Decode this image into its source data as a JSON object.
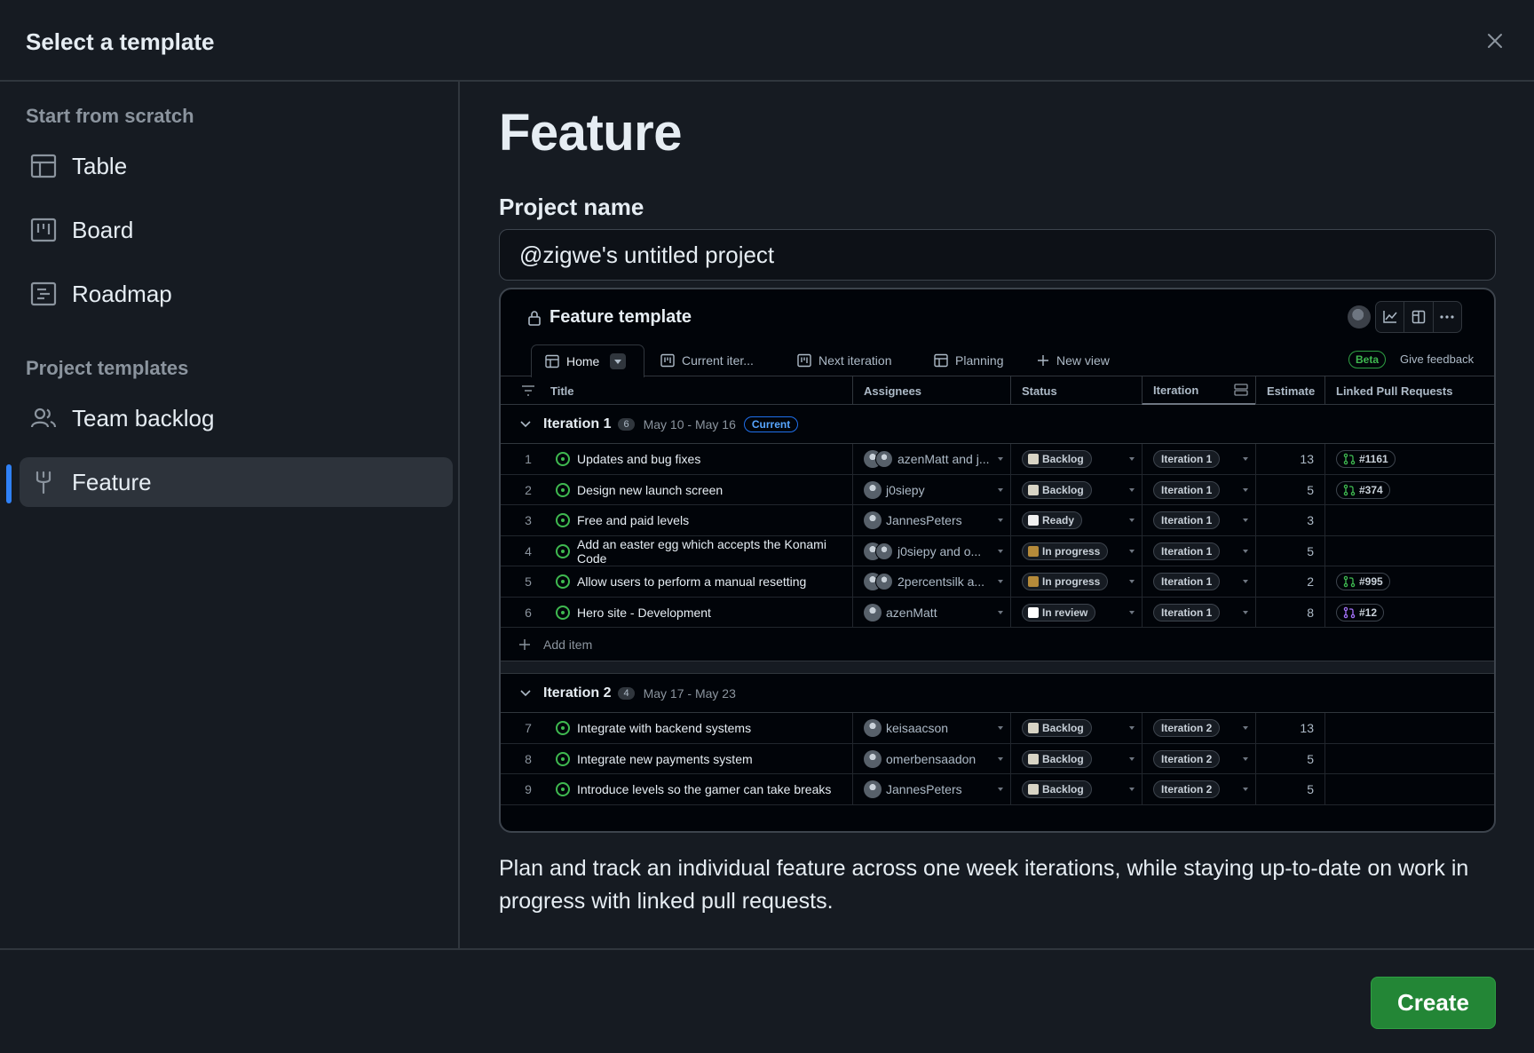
{
  "dialog": {
    "title": "Select a template",
    "close_label": "×"
  },
  "sidebar": {
    "scratch_heading": "Start from scratch",
    "scratch_items": [
      {
        "label": "Table",
        "icon": "table-icon"
      },
      {
        "label": "Board",
        "icon": "board-icon"
      },
      {
        "label": "Roadmap",
        "icon": "roadmap-icon"
      }
    ],
    "templates_heading": "Project templates",
    "template_items": [
      {
        "label": "Team backlog",
        "icon": "people-icon"
      },
      {
        "label": "Feature",
        "icon": "feature-icon",
        "selected": true
      }
    ]
  },
  "main": {
    "template_title": "Feature",
    "project_name_label": "Project name",
    "project_name_value": "@zigwe's untitled project",
    "description": "Plan and track an individual feature across one week iterations, while staying up-to-date on work in progress with linked pull requests."
  },
  "preview": {
    "title": "Feature template",
    "tabs": [
      "Home",
      "Current iter...",
      "Next iteration",
      "Planning",
      "New view"
    ],
    "beta_label": "Beta",
    "feedback_label": "Give feedback",
    "columns": [
      "Title",
      "Assignees",
      "Status",
      "Iteration",
      "Estimate",
      "Linked Pull Requests"
    ],
    "groups": [
      {
        "title": "Iteration 1",
        "count": "6",
        "dates": "May 10 - May 16",
        "badge": "Current",
        "rows": [
          {
            "num": "1",
            "title": "Updates and bug fixes",
            "assignee": "azenMatt and j...",
            "status": "Backlog",
            "iteration": "Iteration 1",
            "estimate": "13",
            "pr": "#1161"
          },
          {
            "num": "2",
            "title": "Design new launch screen",
            "assignee": "j0siepy",
            "status": "Backlog",
            "iteration": "Iteration 1",
            "estimate": "5",
            "pr": "#374"
          },
          {
            "num": "3",
            "title": "Free and paid levels",
            "assignee": "JannesPeters",
            "status": "Ready",
            "iteration": "Iteration 1",
            "estimate": "3",
            "pr": ""
          },
          {
            "num": "4",
            "title": "Add an easter egg which accepts the Konami Code",
            "assignee": "j0siepy and o...",
            "status": "In progress",
            "iteration": "Iteration 1",
            "estimate": "5",
            "pr": ""
          },
          {
            "num": "5",
            "title": "Allow users to perform a manual resetting",
            "assignee": "2percentsilk a...",
            "status": "In progress",
            "iteration": "Iteration 1",
            "estimate": "2",
            "pr": "#995"
          },
          {
            "num": "6",
            "title": "Hero site - Development",
            "assignee": "azenMatt",
            "status": "In review",
            "iteration": "Iteration 1",
            "estimate": "8",
            "pr": "#12"
          }
        ],
        "add_label": "Add item"
      },
      {
        "title": "Iteration 2",
        "count": "4",
        "dates": "May 17 - May 23",
        "badge": "",
        "rows": [
          {
            "num": "7",
            "title": "Integrate with backend systems",
            "assignee": "keisaacson",
            "status": "Backlog",
            "iteration": "Iteration 2",
            "estimate": "13",
            "pr": ""
          },
          {
            "num": "8",
            "title": "Integrate new payments system",
            "assignee": "omerbensaadon",
            "status": "Backlog",
            "iteration": "Iteration 2",
            "estimate": "5",
            "pr": ""
          },
          {
            "num": "9",
            "title": "Introduce levels so the gamer can take breaks",
            "assignee": "JannesPeters",
            "status": "Backlog",
            "iteration": "Iteration 2",
            "estimate": "5",
            "pr": ""
          }
        ]
      }
    ]
  },
  "footer": {
    "create_label": "Create"
  },
  "colors": {
    "accent": "#2f81f7",
    "create_green": "#238636",
    "open_issue_green": "#3fb950"
  }
}
